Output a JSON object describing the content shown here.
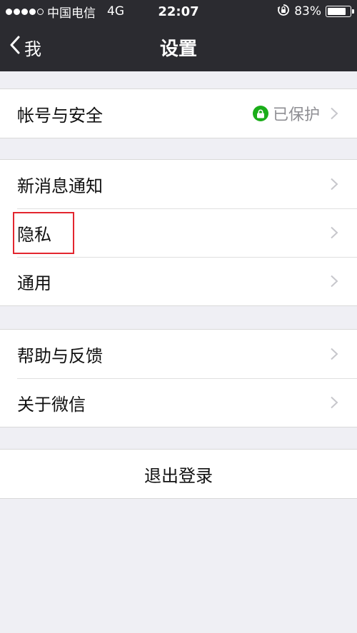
{
  "status_bar": {
    "signal_dots": [
      true,
      true,
      true,
      true,
      false
    ],
    "carrier": "中国电信",
    "network": "4G",
    "time": "22:07",
    "battery_percent_text": "83%",
    "battery_level": 0.83
  },
  "nav": {
    "back_label": "我",
    "title": "设置"
  },
  "groups": [
    {
      "items": [
        {
          "label": "帐号与安全",
          "status": "已保护",
          "status_icon": "lock-icon"
        }
      ]
    },
    {
      "items": [
        {
          "label": "新消息通知"
        },
        {
          "label": "隐私"
        },
        {
          "label": "通用"
        }
      ]
    },
    {
      "items": [
        {
          "label": "帮助与反馈"
        },
        {
          "label": "关于微信"
        }
      ]
    }
  ],
  "logout_label": "退出登录",
  "colors": {
    "nav_bg": "#2b2b30",
    "page_bg": "#efeff4",
    "lock_green": "#1aad19",
    "highlight_red": "#e3262f"
  }
}
